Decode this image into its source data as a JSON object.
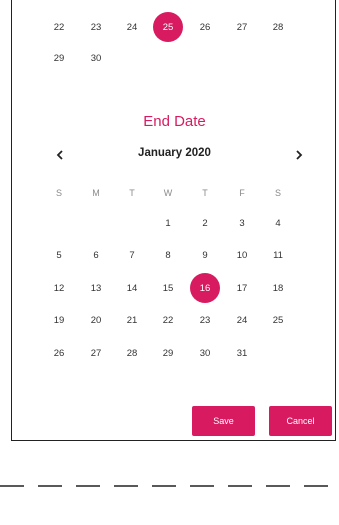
{
  "start_calendar": {
    "weeks": [
      [
        "22",
        "23",
        "24",
        "25",
        "26",
        "27",
        "28"
      ],
      [
        "29",
        "30"
      ]
    ],
    "selected_day": "25"
  },
  "end_calendar": {
    "title": "End Date",
    "month_label": "January 2020",
    "prev_icon": "chevron-left-icon",
    "next_icon": "chevron-right-icon",
    "weekdays": [
      "S",
      "M",
      "T",
      "W",
      "T",
      "F",
      "S"
    ],
    "weeks": [
      [
        "",
        "",
        "",
        "1",
        "2",
        "3",
        "4"
      ],
      [
        "5",
        "6",
        "7",
        "8",
        "9",
        "10",
        "11"
      ],
      [
        "12",
        "13",
        "14",
        "15",
        "16",
        "17",
        "18"
      ],
      [
        "19",
        "20",
        "21",
        "22",
        "23",
        "24",
        "25"
      ],
      [
        "26",
        "27",
        "28",
        "29",
        "30",
        "31",
        ""
      ]
    ],
    "selected_day": "16"
  },
  "actions": {
    "save_label": "Save",
    "cancel_label": "Cancel"
  },
  "colors": {
    "accent": "#d81b60",
    "text": "#333333",
    "weekday": "#8a8a8a",
    "border": "#222222"
  }
}
